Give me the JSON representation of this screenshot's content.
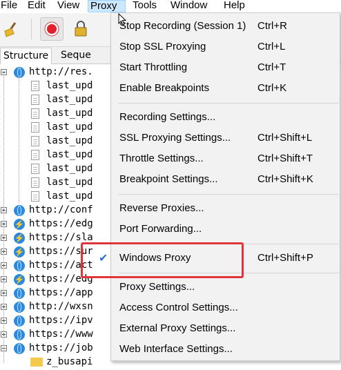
{
  "menubar": {
    "items": [
      "File",
      "Edit",
      "View",
      "Proxy",
      "Tools",
      "Window",
      "Help"
    ],
    "active": "Proxy"
  },
  "tabs": {
    "items": [
      "Structure",
      "Sequence"
    ],
    "partial_second": "Seque"
  },
  "tree": {
    "rows": [
      {
        "kind": "host",
        "expanded": true,
        "icon": "globe-icon",
        "text": "http://res."
      },
      {
        "kind": "file",
        "text": "last_upd"
      },
      {
        "kind": "file",
        "text": "last_upd"
      },
      {
        "kind": "file",
        "text": "last_upd"
      },
      {
        "kind": "file",
        "text": "last_upd"
      },
      {
        "kind": "file",
        "text": "last_upd"
      },
      {
        "kind": "file",
        "text": "last_upd"
      },
      {
        "kind": "file",
        "text": "last_upd"
      },
      {
        "kind": "file",
        "text": "last_upd"
      },
      {
        "kind": "file",
        "text": "last_upd"
      },
      {
        "kind": "host",
        "expanded": false,
        "icon": "globe-icon",
        "text": "http://conf"
      },
      {
        "kind": "host",
        "expanded": false,
        "icon": "bolt-icon",
        "text": "https://edg"
      },
      {
        "kind": "host",
        "expanded": false,
        "icon": "bolt-icon",
        "text": "https://sla"
      },
      {
        "kind": "host",
        "expanded": false,
        "icon": "bolt-icon",
        "text": "https://sur"
      },
      {
        "kind": "host",
        "expanded": false,
        "icon": "globe-icon",
        "text": "https://act"
      },
      {
        "kind": "host",
        "expanded": false,
        "icon": "bolt-icon",
        "text": "https://edg"
      },
      {
        "kind": "host",
        "expanded": false,
        "icon": "globe-icon",
        "text": "https://app"
      },
      {
        "kind": "host",
        "expanded": false,
        "icon": "globe-icon",
        "text": "http://wxsn"
      },
      {
        "kind": "host",
        "expanded": false,
        "icon": "globe-icon",
        "text": "https://ipv"
      },
      {
        "kind": "host",
        "expanded": false,
        "icon": "globe-icon",
        "text": "https://www"
      },
      {
        "kind": "host",
        "expanded": true,
        "icon": "globe-icon",
        "text": "https://job"
      },
      {
        "kind": "folder",
        "text": "z_busapi"
      }
    ]
  },
  "proxy_menu": {
    "groups": [
      [
        {
          "label": "Stop Recording (Session 1)",
          "shortcut": "Ctrl+R"
        },
        {
          "label": "Stop SSL Proxying",
          "shortcut": "Ctrl+L"
        },
        {
          "label": "Start Throttling",
          "shortcut": "Ctrl+T"
        },
        {
          "label": "Enable Breakpoints",
          "shortcut": "Ctrl+K"
        }
      ],
      [
        {
          "label": "Recording Settings...",
          "shortcut": ""
        },
        {
          "label": "SSL Proxying Settings...",
          "shortcut": "Ctrl+Shift+L"
        },
        {
          "label": "Throttle Settings...",
          "shortcut": "Ctrl+Shift+T"
        },
        {
          "label": "Breakpoint Settings...",
          "shortcut": "Ctrl+Shift+K"
        }
      ],
      [
        {
          "label": "Reverse Proxies...",
          "shortcut": ""
        },
        {
          "label": "Port Forwarding...",
          "shortcut": ""
        }
      ],
      [
        {
          "label": "Windows Proxy",
          "shortcut": "Ctrl+Shift+P",
          "checked": true,
          "highlighted": true
        }
      ],
      [
        {
          "label": "Proxy Settings...",
          "shortcut": ""
        },
        {
          "label": "Access Control Settings...",
          "shortcut": ""
        },
        {
          "label": "External Proxy Settings...",
          "shortcut": ""
        },
        {
          "label": "Web Interface Settings...",
          "shortcut": ""
        }
      ]
    ],
    "check_glyph": "✔"
  },
  "colors": {
    "menu_bg": "#f2f2f2",
    "active_menu_bg": "#cce8ff",
    "highlight_border": "#e0343a",
    "check": "#2a6fd1",
    "record_red": "#e0202a"
  }
}
